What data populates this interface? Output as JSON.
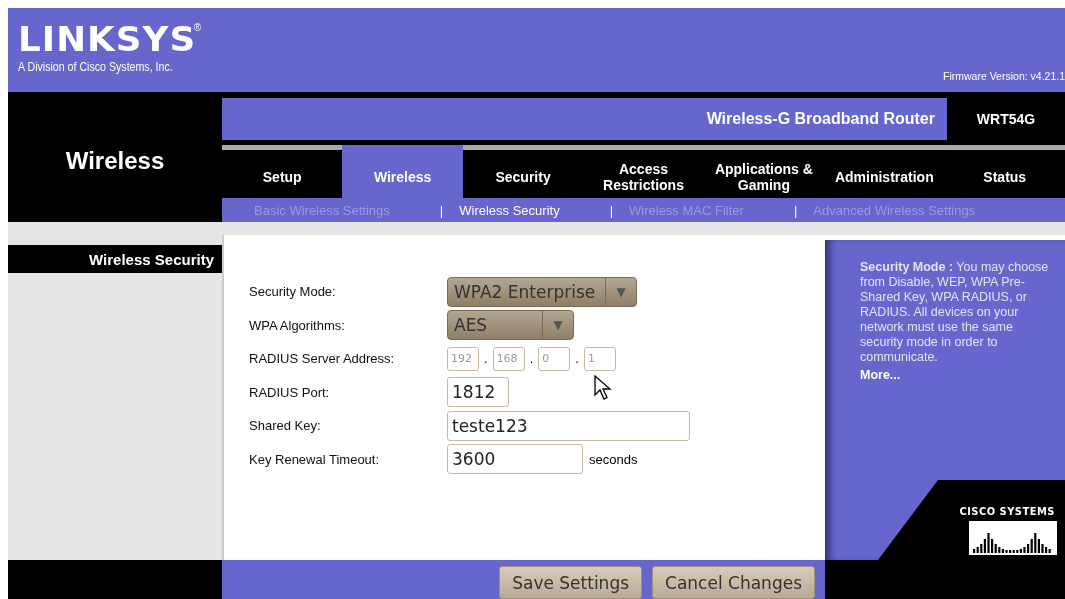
{
  "header": {
    "logo": "LINKSYS",
    "registered_mark": "®",
    "tagline": "A Division of Cisco Systems, Inc.",
    "firmware": "Firmware Version: v4.21.1"
  },
  "section_title": "Wireless",
  "product": {
    "title": "Wireless-G Broadband Router",
    "model": "WRT54G"
  },
  "tabs": [
    {
      "label": "Setup",
      "selected": false
    },
    {
      "label": "Wireless",
      "selected": true
    },
    {
      "label": "Security",
      "selected": false
    },
    {
      "label": "Access Restrictions",
      "selected": false
    },
    {
      "label": "Applications & Gaming",
      "selected": false
    },
    {
      "label": "Administration",
      "selected": false
    },
    {
      "label": "Status",
      "selected": false
    }
  ],
  "subtabs": [
    {
      "label": "Basic Wireless Settings",
      "selected": false
    },
    {
      "separator": "|",
      "label": "Wireless Security",
      "selected": true
    },
    {
      "separator": "|",
      "label": "Wireless MAC Filter",
      "selected": false
    },
    {
      "separator": "|",
      "label": "Advanced Wireless Settings",
      "selected": false
    }
  ],
  "sidebar_heading": "Wireless Security",
  "form": [
    {
      "kind": "select",
      "label": "Security Mode:",
      "value": "WPA2 Enterprise",
      "arrow": "▼"
    },
    {
      "kind": "select",
      "label": "WPA Algorithms:",
      "value": "AES",
      "arrow": "▼"
    },
    {
      "kind": "ip",
      "label": "RADIUS Server Address:",
      "disabled": true,
      "octets": [
        {
          "value": "192"
        },
        {
          "dot": ".",
          "value": "168"
        },
        {
          "dot": ".",
          "value": "0"
        },
        {
          "dot": ".",
          "value": "1"
        }
      ]
    },
    {
      "kind": "text",
      "label": "RADIUS Port:",
      "value": "1812"
    },
    {
      "kind": "text",
      "label": "Shared Key:",
      "value": "teste123"
    },
    {
      "kind": "text",
      "label": "Key Renewal Timeout:",
      "value": "3600",
      "unit": "seconds"
    }
  ],
  "help": {
    "text": "**Security Mode :** You may choose from Disable, WEP, WPA Pre-Shared Key, WPA RADIUS, or RADIUS. All devices on your network must use the same security mode in order to communicate.",
    "more": "More..."
  },
  "brand": "CISCO SYSTEMS",
  "buttons": [
    "Save Settings",
    "Cancel Changes"
  ]
}
